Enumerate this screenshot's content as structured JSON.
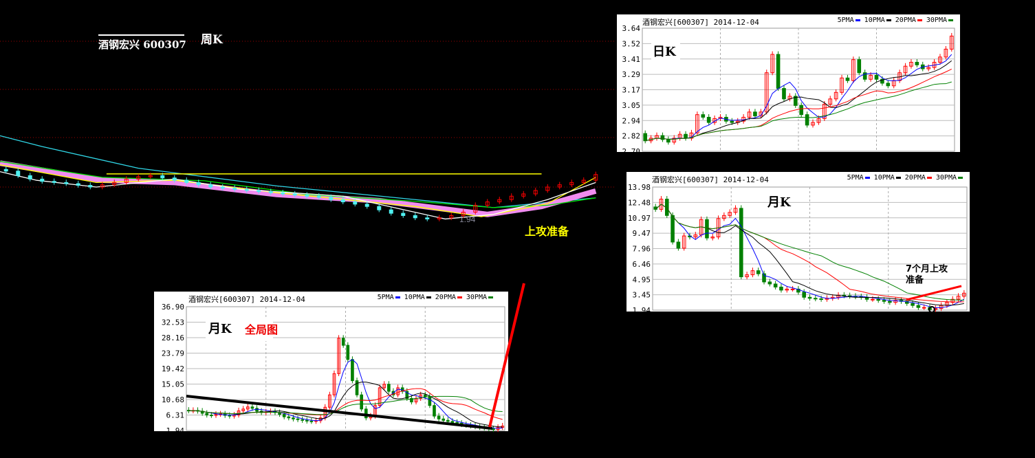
{
  "legend": [
    {
      "name": "5PMA",
      "color": "#0000ff"
    },
    {
      "name": "10PMA",
      "color": "#000000"
    },
    {
      "name": "20PMA",
      "color": "#ff0000"
    },
    {
      "name": "30PMA",
      "color": "#008000"
    }
  ],
  "colors": {
    "up": "#ff0000",
    "down_weekly": "#4ff0f0",
    "down": "#008000",
    "pink_band": "#f08cf0"
  },
  "chart_data": [
    {
      "id": "weekly",
      "type": "candlestick",
      "title": "酒钢宏兴 600307",
      "label": "周K",
      "low_label": "1.94",
      "annotation": "上攻准备",
      "ylim": [
        1.7,
        5.8
      ],
      "xlim": [
        0,
        100
      ],
      "closes": [
        2.8,
        2.72,
        2.66,
        2.62,
        2.6,
        2.58,
        2.55,
        2.52,
        2.56,
        2.6,
        2.66,
        2.7,
        2.72,
        2.68,
        2.64,
        2.6,
        2.56,
        2.52,
        2.5,
        2.48,
        2.46,
        2.44,
        2.42,
        2.4,
        2.38,
        2.36,
        2.34,
        2.3,
        2.26,
        2.22,
        2.18,
        2.12,
        2.06,
        2.02,
        1.98,
        1.96,
        1.98,
        2.02,
        2.08,
        2.2,
        2.26,
        2.3,
        2.36,
        2.4,
        2.46,
        2.52,
        2.56,
        2.6,
        2.64,
        2.74
      ],
      "resistance": {
        "price": 2.75,
        "from": 17.7,
        "to": 90
      },
      "lines": [
        {
          "name": "cyan",
          "color": "#30d8e8",
          "points": [
            [
              0,
              3.42
            ],
            [
              7,
              3.23
            ],
            [
              23,
              2.85
            ],
            [
              46,
              2.54
            ],
            [
              69,
              2.3
            ],
            [
              82,
              2.16
            ],
            [
              99,
              2.33
            ]
          ]
        },
        {
          "name": "pink",
          "color": "#f08cf0",
          "points": [
            [
              0,
              2.94
            ],
            [
              17,
              2.64
            ],
            [
              29,
              2.6
            ],
            [
              46,
              2.39
            ],
            [
              63,
              2.28
            ],
            [
              81,
              2.04
            ],
            [
              90,
              2.18
            ],
            [
              99,
              2.45
            ]
          ]
        },
        {
          "name": "green",
          "color": "#00e000",
          "points": [
            [
              0,
              2.97
            ],
            [
              17,
              2.69
            ],
            [
              34,
              2.63
            ],
            [
              51,
              2.39
            ],
            [
              69,
              2.27
            ],
            [
              82,
              2.16
            ],
            [
              91,
              2.2
            ],
            [
              99,
              2.33
            ]
          ]
        },
        {
          "name": "yellow",
          "color": "#ffff00",
          "points": [
            [
              0,
              2.91
            ],
            [
              16,
              2.6
            ],
            [
              29,
              2.64
            ],
            [
              46,
              2.42
            ],
            [
              69,
              2.18
            ],
            [
              80,
              2.0
            ],
            [
              91,
              2.23
            ],
            [
              99,
              2.69
            ]
          ]
        },
        {
          "name": "white",
          "color": "#ffffff",
          "points": [
            [
              0,
              2.79
            ],
            [
              6,
              2.64
            ],
            [
              16,
              2.52
            ],
            [
              29,
              2.66
            ],
            [
              40,
              2.48
            ],
            [
              57,
              2.36
            ],
            [
              74,
              1.96
            ],
            [
              82,
              2.04
            ],
            [
              91,
              2.3
            ],
            [
              99,
              2.6
            ]
          ]
        }
      ]
    },
    {
      "id": "daily",
      "type": "candlestick",
      "header": "酒钢宏兴[600307] 2014-12-04",
      "label": "日K",
      "ylim": [
        2.7,
        3.64
      ],
      "yticks": [
        "3.64",
        "3.52",
        "3.41",
        "3.29",
        "3.17",
        "3.05",
        "2.94",
        "2.82",
        "2.70"
      ],
      "ma_periods": [
        5,
        10,
        20,
        30
      ],
      "closes": [
        2.78,
        2.8,
        2.82,
        2.79,
        2.77,
        2.8,
        2.83,
        2.8,
        2.84,
        2.98,
        2.96,
        2.92,
        2.95,
        2.96,
        2.93,
        2.92,
        2.93,
        2.96,
        3.0,
        2.97,
        3.0,
        3.3,
        3.44,
        3.18,
        3.1,
        3.12,
        3.05,
        2.98,
        2.9,
        2.92,
        2.95,
        3.06,
        3.1,
        3.15,
        3.26,
        3.24,
        3.4,
        3.3,
        3.25,
        3.28,
        3.25,
        3.22,
        3.2,
        3.24,
        3.3,
        3.35,
        3.38,
        3.36,
        3.33,
        3.34,
        3.38,
        3.42,
        3.48,
        3.58
      ]
    },
    {
      "id": "monthly",
      "type": "candlestick",
      "header": "酒钢宏兴[600307] 2014-12-04",
      "label": "月K",
      "annotation_line1": "7个月上攻",
      "annotation_line2": "准备",
      "ylim": [
        1.94,
        13.98
      ],
      "yticks": [
        "13.98",
        "12.48",
        "10.97",
        "9.47",
        "7.96",
        "6.46",
        "4.95",
        "3.45",
        "1.94"
      ],
      "ma_periods": [
        5,
        10,
        20,
        30
      ],
      "closes": [
        11.8,
        12.8,
        11.2,
        8.6,
        8.0,
        9.2,
        9.1,
        9.3,
        10.8,
        9.0,
        9.1,
        10.9,
        11.2,
        11.5,
        11.9,
        5.2,
        5.4,
        5.8,
        5.5,
        4.7,
        4.5,
        4.2,
        3.9,
        4.0,
        4.0,
        3.7,
        3.2,
        3.1,
        3.05,
        3.0,
        3.1,
        3.2,
        3.4,
        3.35,
        3.3,
        3.25,
        3.2,
        3.0,
        3.0,
        2.9,
        2.8,
        2.7,
        2.9,
        2.8,
        2.6,
        2.4,
        2.2,
        2.2,
        2.0,
        2.1,
        2.4,
        2.7,
        3.0,
        3.3,
        3.6
      ]
    },
    {
      "id": "monthly_full",
      "type": "candlestick",
      "header": "酒钢宏兴[600307] 2014-12-04",
      "label": "月K",
      "sublabel": "全局图",
      "ylim": [
        1.94,
        36.9
      ],
      "yticks": [
        "36.90",
        "32.53",
        "28.16",
        "23.79",
        "19.42",
        "15.05",
        "10.68",
        "6.31",
        "1.94"
      ],
      "ma_periods": [
        5,
        10,
        20,
        30
      ],
      "closes": [
        7.5,
        7.6,
        7.4,
        6.8,
        6.3,
        6.2,
        6.5,
        6.6,
        6.2,
        6.0,
        6.3,
        7.5,
        8.0,
        8.6,
        8.2,
        7.4,
        7.0,
        7.2,
        7.3,
        7.0,
        6.5,
        5.8,
        5.5,
        5.2,
        5.0,
        4.8,
        4.6,
        4.5,
        4.7,
        5.5,
        8.5,
        12,
        18,
        28,
        26,
        22,
        16,
        12,
        8,
        5.5,
        6,
        9,
        14,
        15,
        13,
        12,
        14,
        13,
        11,
        10,
        11,
        12,
        11.5,
        9,
        6,
        5.2,
        4.8,
        4.5,
        4.2,
        4,
        3.6,
        3.4,
        3.2,
        3.0,
        2.8,
        2.6,
        2.4,
        2.2,
        2.8,
        3.2
      ]
    }
  ]
}
